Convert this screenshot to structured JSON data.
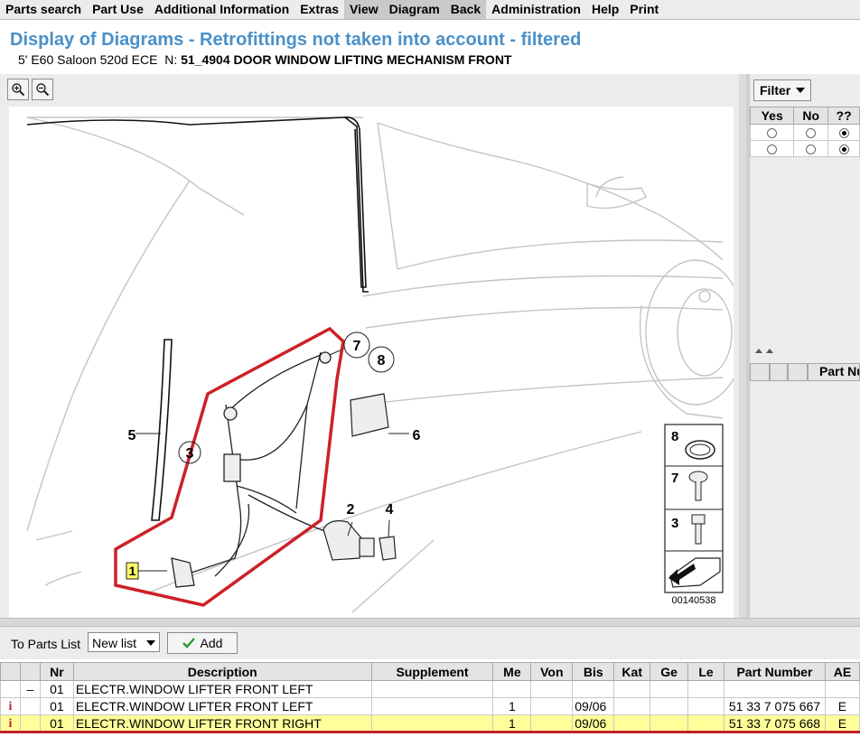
{
  "menu": [
    "Parts search",
    "Part Use",
    "Additional Information",
    "Extras",
    "View",
    "Diagram",
    "Back",
    "Administration",
    "Help",
    "Print"
  ],
  "menu_selected": [
    "View",
    "Diagram",
    "Back"
  ],
  "header": {
    "title": "Display of Diagrams - Retrofittings not taken into account - filtered",
    "vehicle": "5' E60 Saloon 520d ECE",
    "n_label": "N:",
    "diagram": "51_4904 DOOR WINDOW LIFTING MECHANISM FRONT"
  },
  "diagram": {
    "callouts": {
      "c1": "1",
      "c2": "2",
      "c3": "3",
      "c4": "4",
      "c5": "5",
      "c6": "6",
      "c7": "7",
      "c8": "8"
    },
    "legend": {
      "l8": "8",
      "l7": "7",
      "l3": "3"
    },
    "image_number": "00140538",
    "highlight_color": "#cc2127"
  },
  "filter": {
    "button_label": "Filter",
    "columns": [
      "Yes",
      "No",
      "??"
    ],
    "rows": [
      [
        "off",
        "off",
        "on"
      ],
      [
        "off",
        "off",
        "on"
      ]
    ],
    "part_number_header": "Part Nu"
  },
  "toolbar": {
    "to_parts_list_label": "To Parts List",
    "list_select_value": "New list",
    "add_label": "Add"
  },
  "parts_table": {
    "headers": {
      "flag": "",
      "minus": "",
      "nr": "Nr",
      "description": "Description",
      "supplement": "Supplement",
      "me": "Me",
      "von": "Von",
      "bis": "Bis",
      "kat": "Kat",
      "ge": "Ge",
      "le": "Le",
      "part_number": "Part Number",
      "ae": "AE"
    },
    "group_row": {
      "minus": "–",
      "nr": "01",
      "description": "ELECTR.WINDOW LIFTER FRONT LEFT"
    },
    "rows": [
      {
        "flag": "i",
        "nr": "01",
        "description": "ELECTR.WINDOW LIFTER FRONT LEFT",
        "supplement": "",
        "me": "1",
        "von": "",
        "bis": "09/06",
        "kat": "",
        "ge": "",
        "le": "",
        "part_number": "51 33 7 075 667",
        "ae": "E"
      },
      {
        "flag": "i",
        "nr": "01",
        "description": "ELECTR.WINDOW LIFTER FRONT RIGHT",
        "supplement": "",
        "me": "1",
        "von": "",
        "bis": "09/06",
        "kat": "",
        "ge": "",
        "le": "",
        "part_number": "51 33 7 075 668",
        "ae": "E"
      }
    ]
  },
  "colors": {
    "title": "#4a90c8",
    "highlight_row": "#ffff9a",
    "info_icon": "#b8232f"
  }
}
